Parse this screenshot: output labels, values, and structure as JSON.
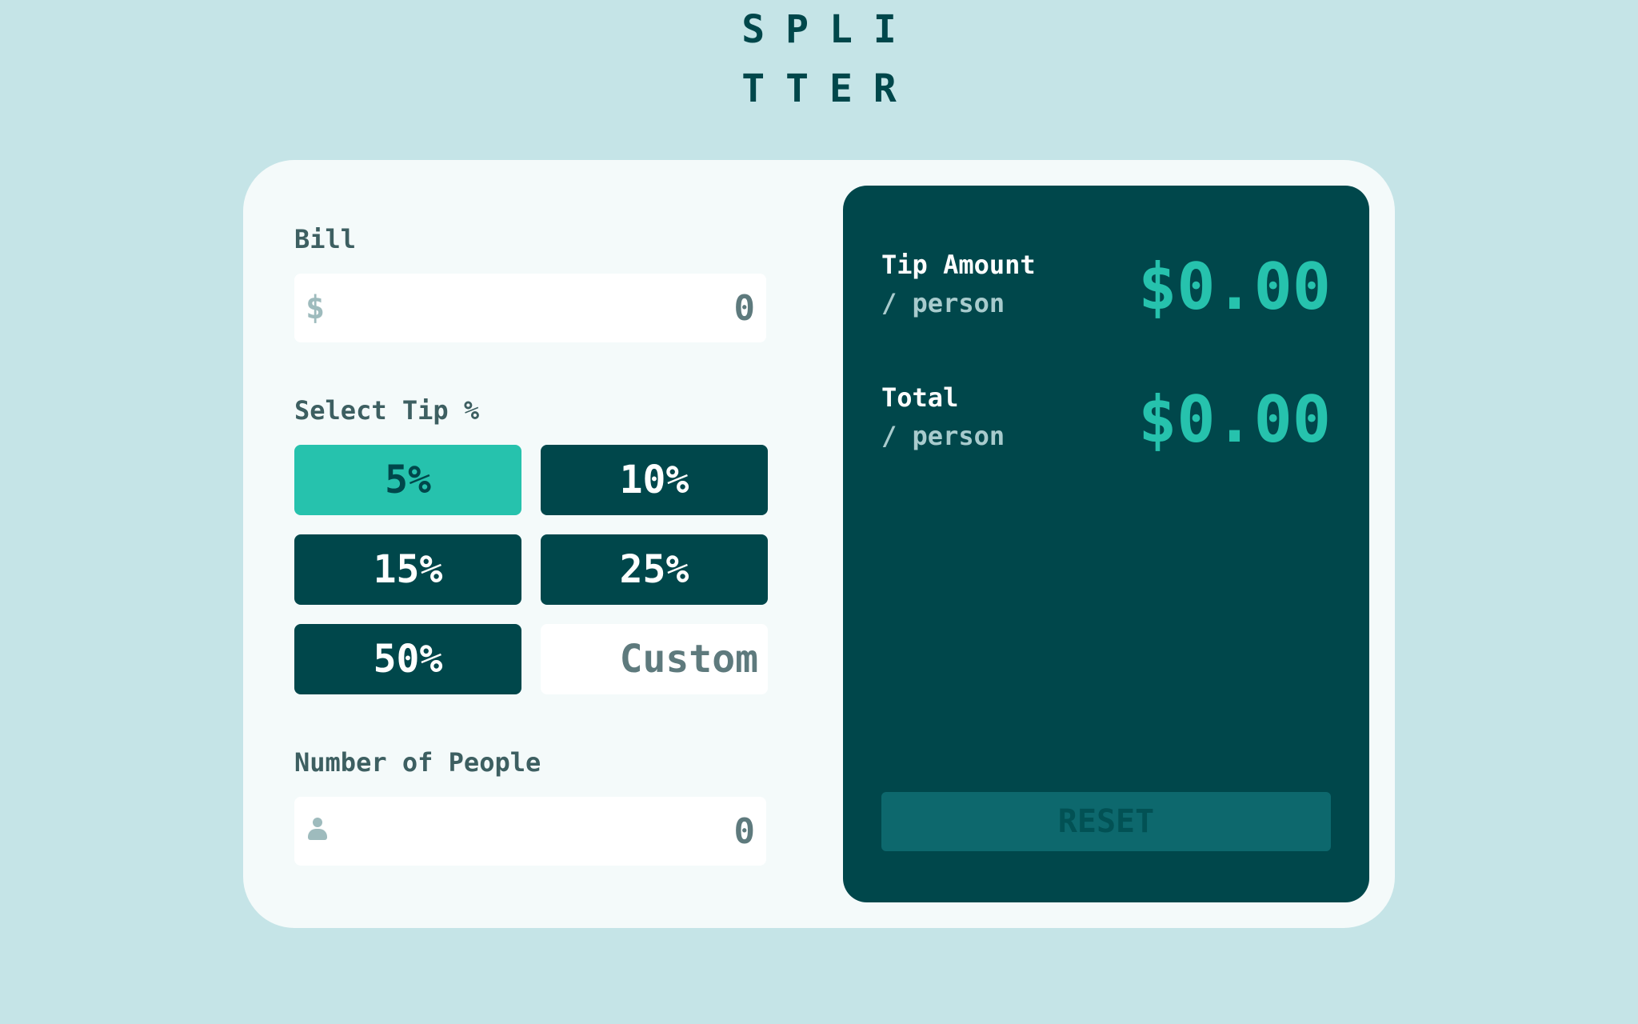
{
  "app": {
    "logo_line1": "SPLI",
    "logo_line2": "TTER"
  },
  "bill": {
    "label": "Bill",
    "currency_symbol": "$",
    "value": "0"
  },
  "tip": {
    "label": "Select Tip %",
    "options": [
      "5%",
      "10%",
      "15%",
      "25%",
      "50%"
    ],
    "selected": "5%",
    "custom_placeholder": "Custom"
  },
  "people": {
    "label": "Number of People",
    "icon": "person-icon",
    "value": "0"
  },
  "results": {
    "tip_amount_label": "Tip Amount",
    "tip_amount_sub": "/ person",
    "tip_amount_value": "$0.00",
    "total_label": "Total",
    "total_sub": "/ person",
    "total_value": "$0.00",
    "reset_label": "RESET"
  },
  "colors": {
    "background": "#c5e4e7",
    "dark_cyan": "#00474b",
    "accent": "#26c2ad"
  }
}
